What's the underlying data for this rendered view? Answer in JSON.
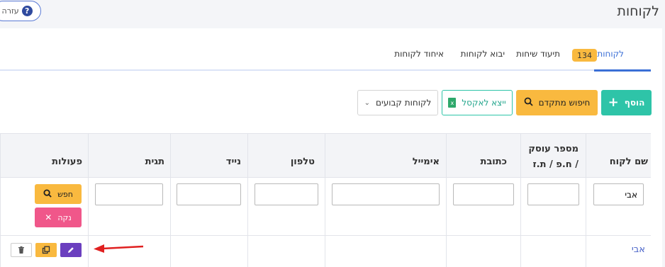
{
  "header": {
    "title": "לקוחות",
    "help_label": "עזרה",
    "help_icon": "?"
  },
  "tabs": [
    {
      "label": "לקוחות",
      "badge": "134",
      "active": true
    },
    {
      "label": "תיעוד שיחות"
    },
    {
      "label": "יבוא לקוחות"
    },
    {
      "label": "איחוד לקוחות"
    }
  ],
  "toolbar": {
    "add_label": "הוסף",
    "advanced_search_label": "חיפוש מתקדם",
    "export_excel_label": "ייצא לאקסל",
    "fixed_customers_label": "לקוחות קבועים"
  },
  "table": {
    "columns": [
      "שם לקוח",
      "מספר עוסק / ח.פ / ת.ז",
      "כתובת",
      "אימייל",
      "טלפון",
      "נייד",
      "תגית",
      "פעולות"
    ],
    "filters": {
      "name_value": "אבי"
    },
    "search_label": "חפש",
    "clear_label": "נקה",
    "rows": [
      {
        "name": "אבי"
      }
    ]
  },
  "colors": {
    "accent": "#3b6fd6",
    "add": "#2ec4a8",
    "warning": "#f9b93f",
    "danger": "#f0578a",
    "edit": "#6b3fbf",
    "arrow": "#e02020"
  }
}
